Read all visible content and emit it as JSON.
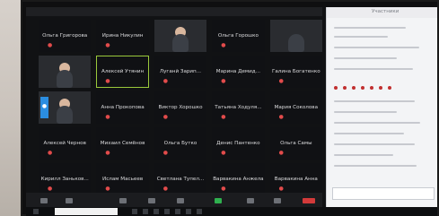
{
  "participants": [
    {
      "name": "Ольга Григорова",
      "video": false
    },
    {
      "name": "Ирина Никулин",
      "video": false
    },
    {
      "name": "",
      "video": true,
      "style": "vid1"
    },
    {
      "name": "Ольга Горошко",
      "video": false
    },
    {
      "name": "",
      "video": true,
      "style": "vid2"
    },
    {
      "name": "",
      "video": true,
      "style": "vid4"
    },
    {
      "name": "Алексей Утянин",
      "video": false,
      "highlight": true
    },
    {
      "name": "Луганй Зарип...",
      "video": false
    },
    {
      "name": "Марина Демид...",
      "video": false
    },
    {
      "name": "Галина Богатенко",
      "video": false
    },
    {
      "name": "",
      "video": true,
      "style": "vid3"
    },
    {
      "name": "Анна Прокопова",
      "video": false
    },
    {
      "name": "Виктор Хорошко",
      "video": false
    },
    {
      "name": "Татьяна Ходуля...",
      "video": false
    },
    {
      "name": "Мария Соколова",
      "video": false
    },
    {
      "name": "Алексей Чернов",
      "video": false
    },
    {
      "name": "Михаил Семёнов",
      "video": false
    },
    {
      "name": "Ольга Бутко",
      "video": false
    },
    {
      "name": "Денис Пантенко",
      "video": false
    },
    {
      "name": "Ольга Самы",
      "video": false
    },
    {
      "name": "Кирилл Заньков...",
      "video": false
    },
    {
      "name": "Ислам Масьеев",
      "video": false
    },
    {
      "name": "Светлана Тупел...",
      "video": false
    },
    {
      "name": "Варвакина Анжела",
      "video": false
    },
    {
      "name": "Варвакина Анна",
      "video": false
    }
  ],
  "side_panel": {
    "title": "Участники"
  },
  "colors": {
    "accent": "#9ac93b",
    "muted_mic": "#e24b4b",
    "badge": "#2b8de0"
  }
}
